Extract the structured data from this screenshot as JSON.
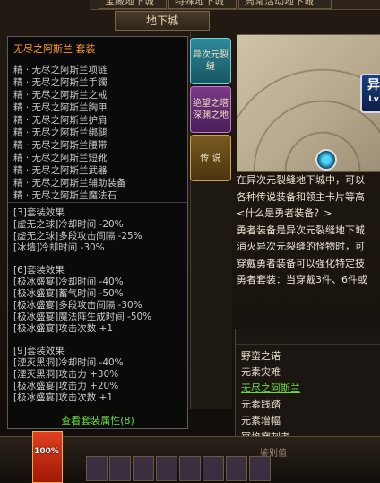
{
  "top_tabs": [
    "宝藏地下城",
    "特殊地下城",
    "周常活动地下城"
  ],
  "sub_tab": "地下城",
  "side_buttons": [
    "异次元裂缝",
    "绝望之塔\n深渊之地",
    "传 说"
  ],
  "map": {
    "badge_text": "异",
    "badge_level": "Lv"
  },
  "description": {
    "lines": [
      "在异次元裂缝地下城中，可以",
      "各种传说装备和领主卡片等高",
      "<什么是勇者装备？>",
      "勇者装备是异次元裂缝地下城",
      "消灭异次元裂缝的怪物时，可",
      "穿戴勇者装备可以强化特定技",
      "勇者套装：当穿戴3件、6件或"
    ]
  },
  "set_list": {
    "items": [
      "野蛮之诺",
      "元素灾难",
      "无尽之阿斯兰",
      "元素践踏",
      "元素增幅",
      "冥焰穿刺者"
    ],
    "selected_index": 2
  },
  "hud": {
    "hp_text": "100%",
    "label": "鉴别值"
  },
  "tooltip": {
    "title": "无尽之阿斯兰  套装",
    "items": [
      "精 · 无尽之阿斯兰项链",
      "精 · 无尽之阿斯兰手镯",
      "精 · 无尽之阿斯兰之戒",
      "精 · 无尽之阿斯兰胸甲",
      "精 · 无尽之阿斯兰护肩",
      "精 · 无尽之阿斯兰绑腿",
      "精 · 无尽之阿斯兰腰带",
      "精 · 无尽之阿斯兰短靴",
      "精 · 无尽之阿斯兰武器",
      "精 · 无尽之阿斯兰辅助装备",
      "精 · 无尽之阿斯兰魔法石"
    ],
    "effects": [
      {
        "header": "[3]套装效果",
        "lines": [
          "[虚无之球]冷却时间 -20%",
          "[虚无之球]多段攻击间隔 -25%",
          "[冰墙]冷却时间 -30%"
        ]
      },
      {
        "header": "[6]套装效果",
        "lines": [
          "[极冰盛宴]冷却时间 -40%",
          "[极冰盛宴]蓄气时间 -50%",
          "[极冰盛宴]多段攻击间隔 -30%",
          "[极冰盛宴]魔法阵生成时间 -50%",
          "[极冰盛宴]攻击次数 +1"
        ]
      },
      {
        "header": "[9]套装效果",
        "lines": [
          "[湮灭黑洞]冷却时间 -40%",
          "[湮灭黑洞]攻击力 +30%",
          "[极冰盛宴]攻击力 +20%",
          "[极冰盛宴]攻击次数 +1"
        ]
      }
    ],
    "link": "查看套装属性(8)"
  },
  "colors": {
    "title": "#ff9d2a",
    "link": "#6bdc3a",
    "selected": "#6bdc3a"
  }
}
